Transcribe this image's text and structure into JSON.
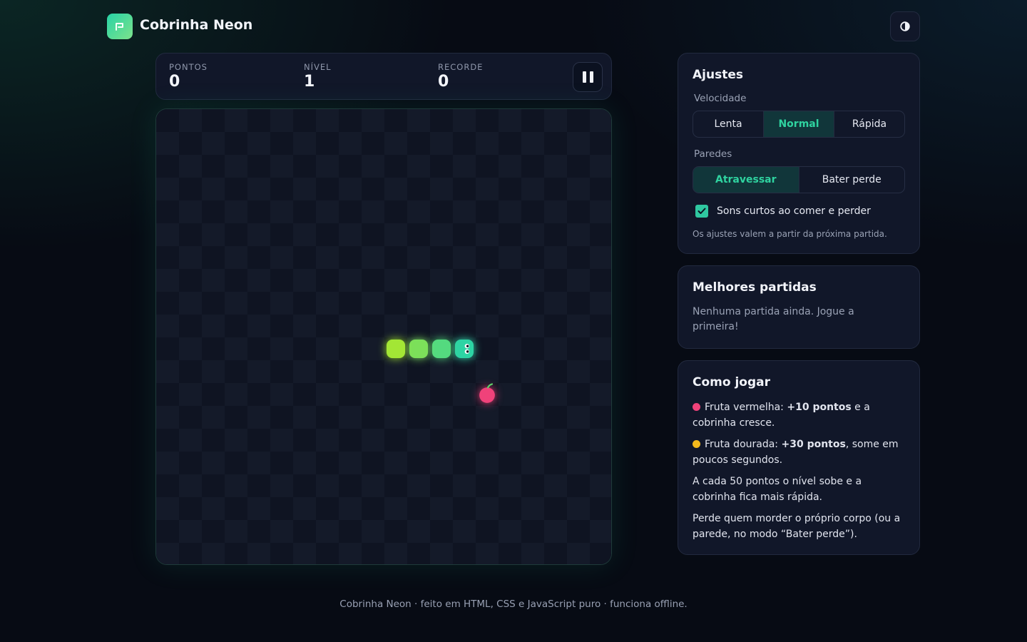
{
  "app": {
    "title": "Cobrinha Neon",
    "theme_toggle_icon": "contrast-icon"
  },
  "colors": {
    "accent": "#2fd3a0",
    "background": "#070b14",
    "card": "#111729",
    "fruit_red": "#f0427a",
    "fruit_gold": "#f3b91c",
    "snake_head": "#2dd4a4",
    "snake_tail": "#a3e635"
  },
  "scoreboard": {
    "points_label": "PONTOS",
    "points_value": "0",
    "level_label": "NÍVEL",
    "level_value": "1",
    "record_label": "RECORDE",
    "record_value": "0",
    "pause_icon": "pause-icon"
  },
  "game": {
    "grid": {
      "cols": 20,
      "rows": 20
    },
    "snake": [
      [
        13,
        10
      ],
      [
        12,
        10
      ],
      [
        11,
        10
      ],
      [
        10,
        10
      ]
    ],
    "fruit": {
      "type": "red",
      "cell": [
        14,
        12
      ]
    },
    "direction": "right"
  },
  "settings": {
    "title": "Ajustes",
    "speed_label": "Velocidade",
    "speed_options": [
      "Lenta",
      "Normal",
      "Rápida"
    ],
    "speed_selected": "Normal",
    "walls_label": "Paredes",
    "walls_options": [
      "Atravessar",
      "Bater perde"
    ],
    "walls_selected": "Atravessar",
    "sound_label": "Sons curtos ao comer e perder",
    "sound_checked": true,
    "note": "Os ajustes valem a partir da próxima partida."
  },
  "best": {
    "title": "Melhores partidas",
    "empty_text": "Nenhuma partida ainda. Jogue a primeira!"
  },
  "howto": {
    "title": "Como jogar",
    "red_prefix": "Fruta vermelha: ",
    "red_points": "+10 pontos",
    "red_suffix": " e a cobrinha cresce.",
    "gold_prefix": "Fruta dourada: ",
    "gold_points": "+30 pontos",
    "gold_suffix": ", some em poucos segundos.",
    "level_text": "A cada 50 pontos o nível sobe e a cobrinha fica mais rápida.",
    "lose_text": "Perde quem morder o próprio corpo (ou a parede, no modo “Bater perde”)."
  },
  "footer": {
    "text": "Cobrinha Neon · feito em HTML, CSS e JavaScript puro · funciona offline."
  }
}
